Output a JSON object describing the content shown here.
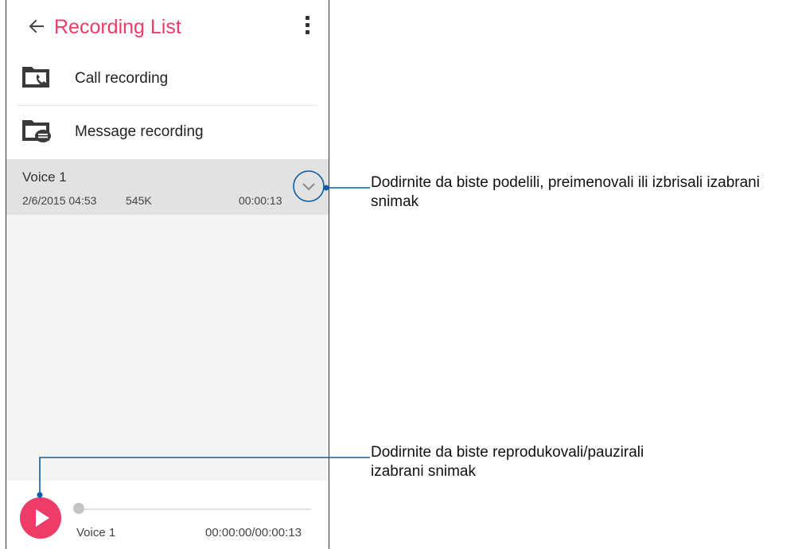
{
  "app": {
    "title": "Recording List",
    "back_icon": "arrow-left-icon",
    "menu_icon": "more-vertical-icon",
    "accent_color": "#ed3c67"
  },
  "folders": [
    {
      "label": "Call recording",
      "icon": "folder-call-icon"
    },
    {
      "label": "Message recording",
      "icon": "folder-message-icon"
    }
  ],
  "recordings": [
    {
      "name": "Voice 1",
      "date": "2/6/2015 04:53",
      "size": "545K",
      "duration": "00:00:13",
      "expand_icon": "chevron-down-icon"
    }
  ],
  "player": {
    "play_icon": "play-icon",
    "track_name": "Voice 1",
    "time": "00:00:00/00:00:13",
    "progress": 0
  },
  "callouts": {
    "expand": "Dodirnite da biste podelili, preimenovali ili izbrisali izabrani snimak",
    "play_line1": "Dodirnite da biste reprodukovali/pauzirali",
    "play_line2": "izabrani snimak",
    "line_color": "#0a5ea8"
  }
}
